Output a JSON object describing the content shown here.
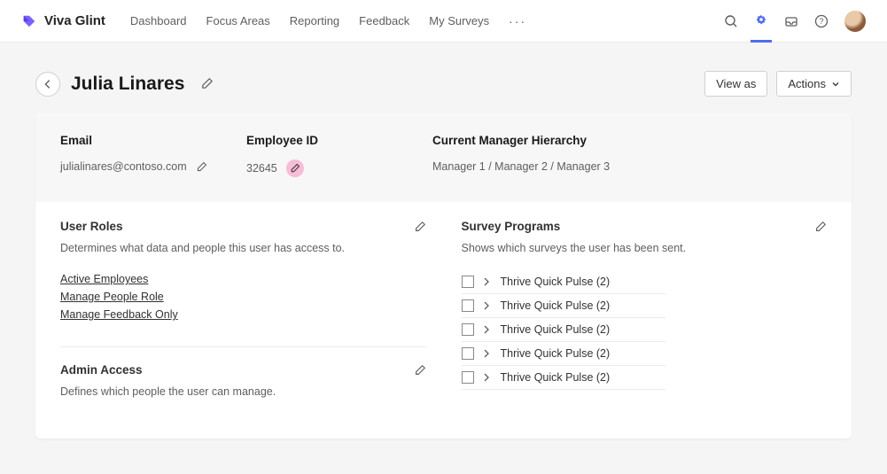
{
  "brand": {
    "name": "Viva Glint"
  },
  "nav": {
    "links": [
      "Dashboard",
      "Focus Areas",
      "Reporting",
      "Feedback",
      "My Surveys"
    ]
  },
  "header": {
    "title": "Julia Linares",
    "view_as": "View as",
    "actions": "Actions"
  },
  "profile": {
    "email_label": "Email",
    "email_value": "julialinares@contoso.com",
    "empid_label": "Employee ID",
    "empid_value": "32645",
    "hierarchy_label": "Current Manager Hierarchy",
    "hierarchy_value": "Manager 1 / Manager 2 / Manager 3"
  },
  "roles": {
    "title": "User Roles",
    "desc": "Determines what data and people this user has access to.",
    "items": [
      "Active Employees",
      "Manage People Role",
      "Manage Feedback Only"
    ]
  },
  "admin": {
    "title": "Admin Access",
    "desc": "Defines which people the user can manage."
  },
  "surveys": {
    "title": "Survey Programs",
    "desc": "Shows which surveys the user has been sent.",
    "items": [
      "Thrive Quick Pulse (2)",
      "Thrive Quick Pulse (2)",
      "Thrive Quick Pulse (2)",
      "Thrive Quick Pulse (2)",
      "Thrive Quick Pulse (2)"
    ]
  }
}
